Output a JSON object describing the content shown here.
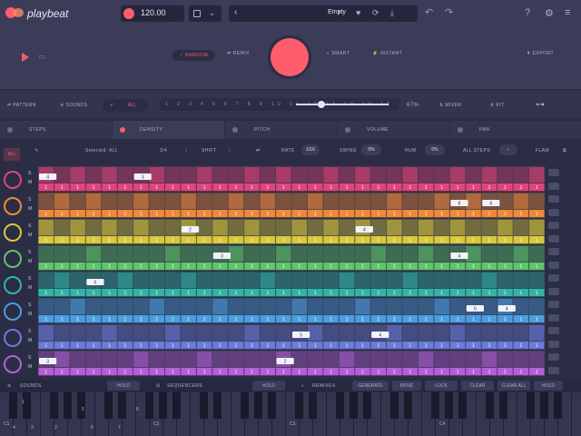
{
  "app": {
    "name": "playbeat"
  },
  "topbar": {
    "tempo": "120.00",
    "preset_name": "Empty",
    "prev_arrow": "‹",
    "next_arrow": "›"
  },
  "transport": {
    "modes": [
      "RANDOM",
      "REMIX",
      "SMART",
      "INSTANT"
    ],
    "active_mode": "RANDOM",
    "export_label": "EXPORT"
  },
  "row2": {
    "left_items": [
      "PATTERN",
      "SOUNDS",
      "ALL"
    ],
    "slider_ticks": [
      "1",
      "2",
      "3",
      "4",
      "5",
      "6",
      "7",
      "8",
      "9",
      "10",
      "11",
      "12",
      "13",
      "14",
      "15",
      "16"
    ],
    "slider_value": "67%",
    "mixer_label": "MIXER",
    "kit_label": "KIT"
  },
  "tabs": [
    "STEPS",
    "DENSITY",
    "PITCH",
    "VOLUME",
    "PAN"
  ],
  "toolbar3": {
    "all_label": "ALL",
    "selected_label": "Selected: ALL",
    "fraction_label": "3/4",
    "shift_label": "SHIFT",
    "rate_label": "RATE",
    "rate_value": "1/16",
    "swing_label": "SWING",
    "swing_value": "0%",
    "humanize_label": "HUM",
    "humanize_value": "0%",
    "all_steps_label": "ALL STEPS",
    "flam_label": "FLAM"
  },
  "sequencer": {
    "row_labels": [
      "S",
      "M"
    ],
    "step_value": "1",
    "rows": [
      {
        "color": "#e0457a",
        "active_steps": [
          0,
          2,
          4,
          7,
          10,
          13,
          15,
          18,
          20,
          23,
          26,
          28,
          31
        ],
        "labels": {
          "0": "4",
          "6": "3"
        }
      },
      {
        "color": "#f0883a",
        "active_steps": [
          1,
          3,
          6,
          9,
          12,
          14,
          17,
          22,
          25,
          27,
          30
        ],
        "labels": {
          "26": "8",
          "28": "6"
        }
      },
      {
        "color": "#d8c83a",
        "active_steps": [
          0,
          2,
          4,
          6,
          9,
          11,
          13,
          16,
          18,
          20,
          22,
          24,
          26,
          29,
          31
        ],
        "labels": {
          "9": "2",
          "20": "4"
        }
      },
      {
        "color": "#5fc56a",
        "active_steps": [
          3,
          8,
          12,
          15,
          21,
          24,
          27,
          30
        ],
        "labels": {
          "11": "3",
          "26": "4"
        }
      },
      {
        "color": "#32b5a8",
        "active_steps": [
          1,
          5,
          9,
          14,
          19,
          23,
          28
        ],
        "labels": {
          "3": "5"
        }
      },
      {
        "color": "#4a9ee0",
        "active_steps": [
          2,
          7,
          11,
          16,
          20,
          25,
          29
        ],
        "labels": {
          "27": "6",
          "29": "4"
        }
      },
      {
        "color": "#6a7bd8",
        "active_steps": [
          0,
          4,
          8,
          13,
          17,
          22,
          26,
          31
        ],
        "labels": {
          "16": "5",
          "21": "4"
        }
      },
      {
        "color": "#b45fd8",
        "active_steps": [
          1,
          6,
          10,
          15,
          19,
          24,
          28
        ],
        "labels": {
          "0": "3",
          "15": "2"
        }
      }
    ]
  },
  "bottombar": {
    "sounds_label": "SOUNDS",
    "hold_label": "HOLD",
    "sequencers_label": "SEQUENCERS",
    "hold2_label": "HOLD",
    "remixes_label": "REMIXES",
    "generate_label": "GENERATE",
    "move_label": "MOVE",
    "lock_label": "LOCK",
    "clear_label": "CLEAR",
    "clear_all_label": "CLEAR ALL",
    "hold3_label": "HOLD"
  },
  "keyboard": {
    "octaves": [
      "C1",
      "C2",
      "C3",
      "C4"
    ],
    "key_numbers": [
      "1",
      "2",
      "3",
      "4",
      "5",
      "6",
      "7",
      "8"
    ]
  }
}
